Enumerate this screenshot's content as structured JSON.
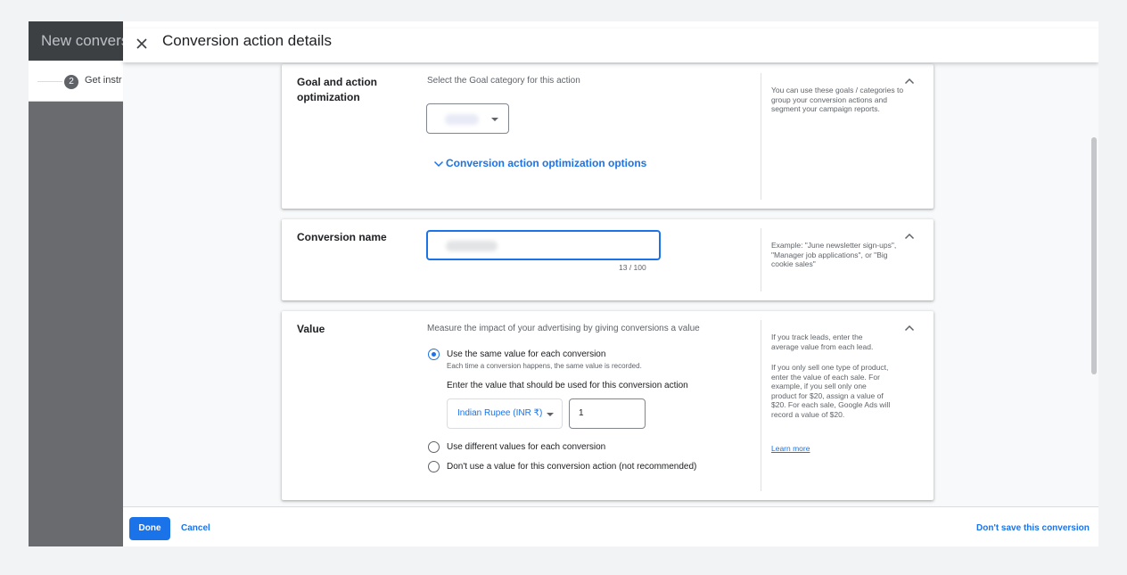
{
  "background": {
    "page_title": "New convers",
    "step_number": "2",
    "step_label": "Get instr"
  },
  "dialog": {
    "title": "Conversion action details"
  },
  "goal_card": {
    "label": "Goal and action optimization",
    "description": "Select the Goal category for this action",
    "optimization_link": "Conversion action optimization options",
    "help": "You can use these goals / categories to group your conversion actions and segment your campaign reports."
  },
  "name_card": {
    "label": "Conversion name",
    "counter": "13 / 100",
    "help": "Example: \"June newsletter sign-ups\", \"Manager job applications\", or \"Big cookie sales\""
  },
  "value_card": {
    "label": "Value",
    "description": "Measure the impact of your advertising by giving conversions a value",
    "option_same": "Use the same value for each conversion",
    "option_same_sub": "Each time a conversion happens, the same value is recorded.",
    "enter_value_label": "Enter the value that should be used for this conversion action",
    "currency": "Indian Rupee (INR ₹)",
    "amount": "1",
    "option_different": "Use different values for each conversion",
    "option_none": "Don't use a value for this conversion action (not recommended)",
    "selected_option": "same",
    "help_1": "If you track leads, enter the average value from each lead.",
    "help_2": "If you only sell one type of product, enter the value of each sale. For example, if you sell only one product for $20, assign a value of $20. For each sale, Google Ads will record a value of $20.",
    "learn_more": "Learn more"
  },
  "footer": {
    "done": "Done",
    "cancel": "Cancel",
    "dont_save": "Don't save this conversion"
  },
  "colors": {
    "accent": "#1a73e8",
    "header_dark": "#3c4043",
    "scrim": "#696b6e"
  }
}
